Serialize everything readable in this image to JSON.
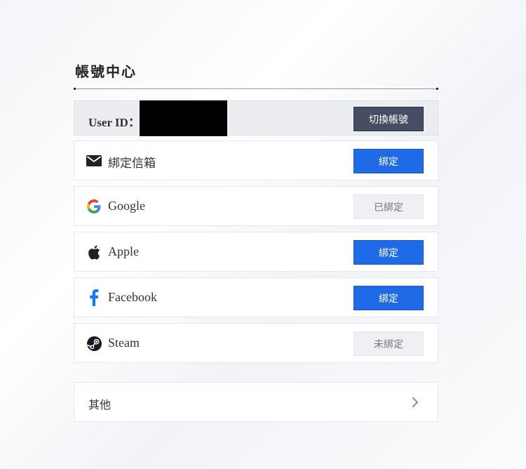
{
  "header": {
    "title": "帳號中心"
  },
  "user": {
    "label": "User ID：",
    "switch_label": "切換帳號"
  },
  "bindings": [
    {
      "name": "綁定信箱",
      "icon": "mail-icon",
      "status": "綁定"
    },
    {
      "name": "Google",
      "icon": "google-icon",
      "status": "已綁定"
    },
    {
      "name": "Apple",
      "icon": "apple-icon",
      "status": "綁定"
    },
    {
      "name": "Facebook",
      "icon": "facebook-icon",
      "status": "綁定"
    },
    {
      "name": "Steam",
      "icon": "steam-icon",
      "status": "未綁定"
    }
  ],
  "other": {
    "label": "其他",
    "icon": "chevron-right-icon"
  },
  "colors": {
    "bind_button": "#1f6ae6",
    "switch_button": "#454e62",
    "bound_button": "#eef0f3"
  }
}
